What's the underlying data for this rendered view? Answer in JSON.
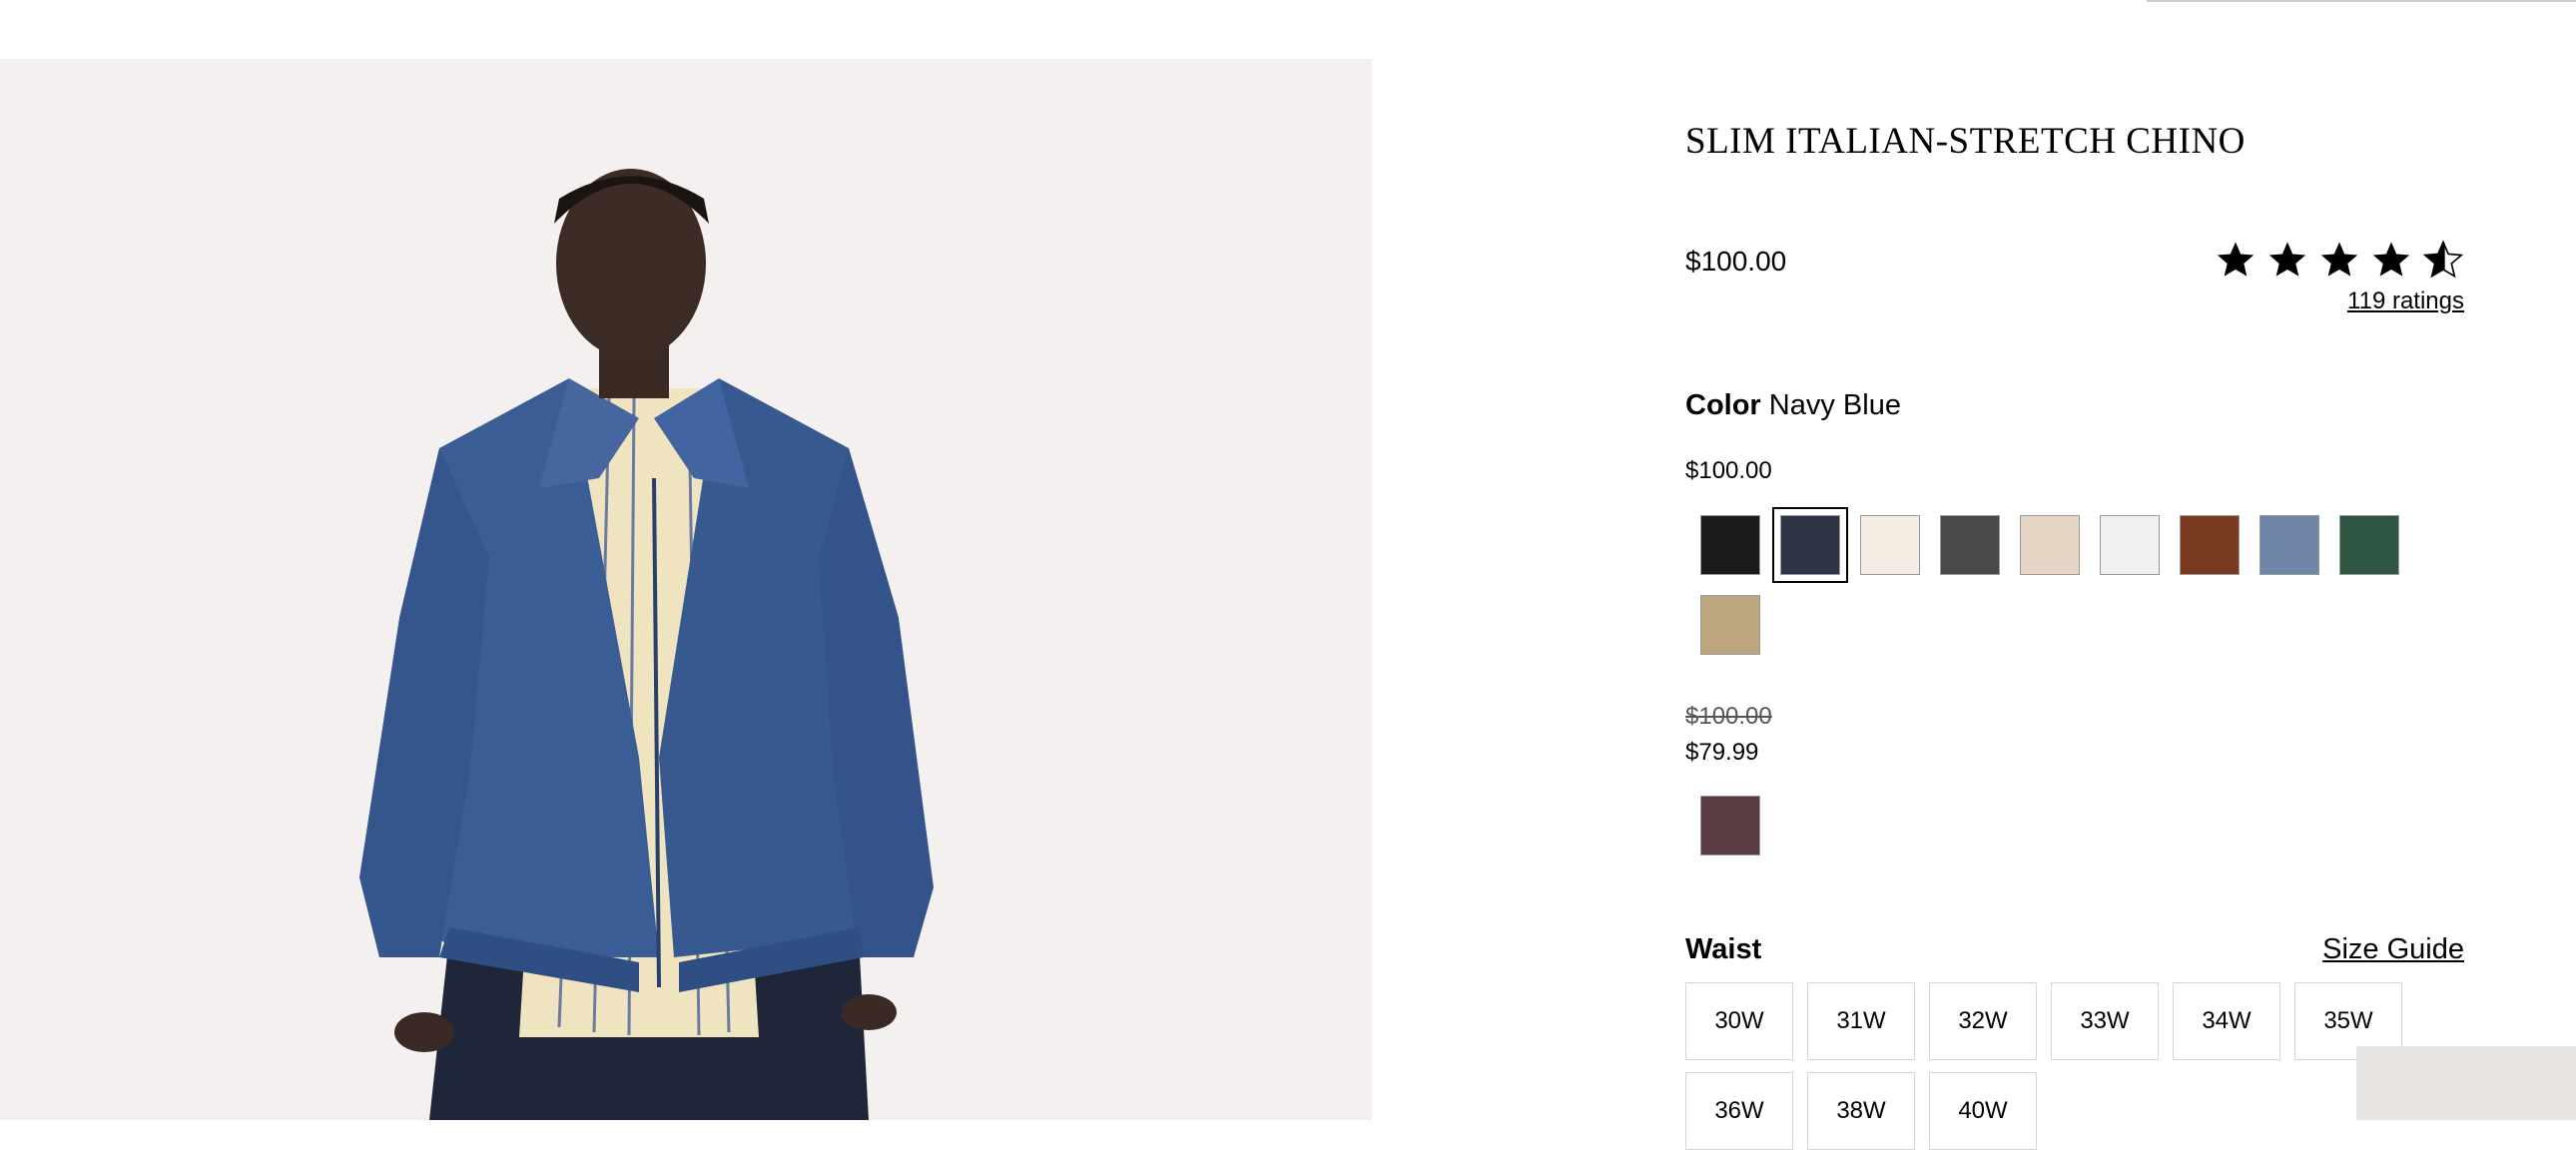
{
  "product": {
    "title": "SLIM ITALIAN-STRETCH CHINO",
    "price": "$100.00",
    "rating": {
      "stars": 4.5,
      "ratings_link": "119 ratings"
    }
  },
  "color": {
    "label": "Color",
    "selected_name": "Navy Blue",
    "regular_group": {
      "price": "$100.00",
      "swatches": [
        {
          "name": "black",
          "hex": "#1c1c1c",
          "selected": false
        },
        {
          "name": "navy",
          "hex": "#2f3445",
          "selected": true
        },
        {
          "name": "ivory",
          "hex": "#f3ece3",
          "selected": false
        },
        {
          "name": "charcoal",
          "hex": "#4b4849",
          "selected": false
        },
        {
          "name": "sand",
          "hex": "#e6d5c5",
          "selected": false
        },
        {
          "name": "white",
          "hex": "#f1f0ee",
          "selected": false
        },
        {
          "name": "rust",
          "hex": "#7a3a22",
          "selected": false
        },
        {
          "name": "slate-blue",
          "hex": "#6f86a8",
          "selected": false
        },
        {
          "name": "forest-green",
          "hex": "#2f5543",
          "selected": false
        },
        {
          "name": "khaki",
          "hex": "#bea77f",
          "selected": false
        }
      ]
    },
    "sale_group": {
      "old_price": "$100.00",
      "price": "$79.99",
      "swatches": [
        {
          "name": "plum",
          "hex": "#5a3b42",
          "selected": false
        }
      ]
    }
  },
  "waist": {
    "label": "Waist",
    "size_guide": "Size Guide",
    "sizes": [
      "30W",
      "31W",
      "32W",
      "33W",
      "34W",
      "35W",
      "36W",
      "38W",
      "40W"
    ]
  }
}
